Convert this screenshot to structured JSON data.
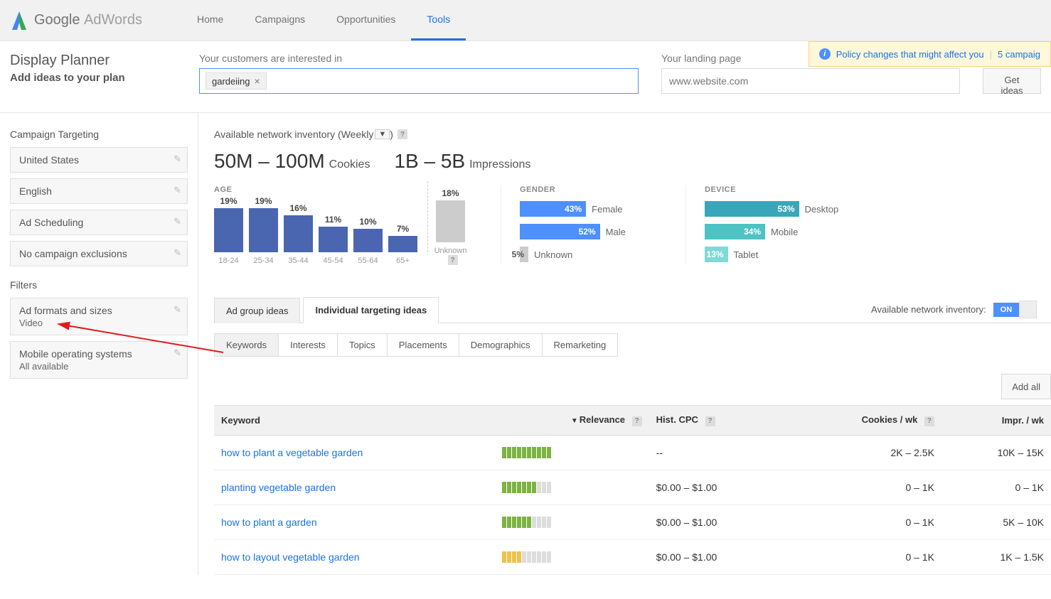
{
  "header": {
    "brand_main": "Google",
    "brand_sub": "AdWords",
    "nav": [
      "Home",
      "Campaigns",
      "Opportunities",
      "Tools"
    ],
    "active_nav": "Tools"
  },
  "policy_banner": {
    "link1": "Policy changes that might affect you",
    "link2": "5 campaig"
  },
  "subheader": {
    "title": "Display Planner",
    "subtitle": "Add ideas to your plan",
    "interest_label": "Your customers are interested in",
    "interest_tag": "gardeiing",
    "landing_label": "Your landing page",
    "landing_placeholder": "www.website.com",
    "get_ideas": "Get ideas"
  },
  "sidebar": {
    "targeting_heading": "Campaign Targeting",
    "targeting": [
      "United States",
      "English",
      "Ad Scheduling",
      "No campaign exclusions"
    ],
    "filters_heading": "Filters",
    "filters": [
      {
        "label": "Ad formats and sizes",
        "sub": "Video"
      },
      {
        "label": "Mobile operating systems",
        "sub": "All available"
      }
    ]
  },
  "inventory": {
    "title": "Available network inventory (Weekly",
    "cookies": "50M – 100M",
    "cookies_label": "Cookies",
    "impressions": "1B – 5B",
    "impressions_label": "Impressions"
  },
  "chart_data": {
    "age": {
      "type": "bar",
      "title": "AGE",
      "categories": [
        "18-24",
        "25-34",
        "35-44",
        "45-54",
        "55-64",
        "65+"
      ],
      "values": [
        19,
        19,
        16,
        11,
        10,
        7
      ],
      "unknown": {
        "label": "Unknown",
        "value": 18
      }
    },
    "gender": {
      "type": "bar",
      "title": "GENDER",
      "series": [
        {
          "name": "Female",
          "value": 43,
          "color": "#4d90fe"
        },
        {
          "name": "Male",
          "value": 52,
          "color": "#4d90fe"
        },
        {
          "name": "Unknown",
          "value": 5,
          "color": "#cccccc"
        }
      ]
    },
    "device": {
      "type": "bar",
      "title": "DEVICE",
      "series": [
        {
          "name": "Desktop",
          "value": 53,
          "color": "#3aa6b9"
        },
        {
          "name": "Mobile",
          "value": 34,
          "color": "#4dc3c3"
        },
        {
          "name": "Tablet",
          "value": 13,
          "color": "#7fd9d9"
        }
      ]
    }
  },
  "ideas_tabs": {
    "tabs": [
      "Ad group ideas",
      "Individual targeting ideas"
    ],
    "active": "Individual targeting ideas",
    "inventory_label": "Available network inventory:",
    "on": "ON"
  },
  "subtabs": {
    "tabs": [
      "Keywords",
      "Interests",
      "Topics",
      "Placements",
      "Demographics",
      "Remarketing"
    ],
    "active": "Keywords"
  },
  "add_all": "Add all",
  "table": {
    "headers": {
      "keyword": "Keyword",
      "relevance": "Relevance",
      "cpc": "Hist. CPC",
      "cookies": "Cookies / wk",
      "impr": "Impr. / wk"
    },
    "rows": [
      {
        "keyword": "how to plant a vegetable garden",
        "rel": 10,
        "relcolor": "g",
        "cpc": "--",
        "cookies": "2K – 2.5K",
        "impr": "10K – 15K"
      },
      {
        "keyword": "planting vegetable garden",
        "rel": 7,
        "relcolor": "g",
        "cpc": "$0.00 – $1.00",
        "cookies": "0 – 1K",
        "impr": "0 – 1K"
      },
      {
        "keyword": "how to plant a garden",
        "rel": 6,
        "relcolor": "g",
        "cpc": "$0.00 – $1.00",
        "cookies": "0 – 1K",
        "impr": "5K – 10K"
      },
      {
        "keyword": "how to layout vegetable garden",
        "rel": 4,
        "relcolor": "y",
        "cpc": "$0.00 – $1.00",
        "cookies": "0 – 1K",
        "impr": "1K – 1.5K"
      }
    ]
  }
}
